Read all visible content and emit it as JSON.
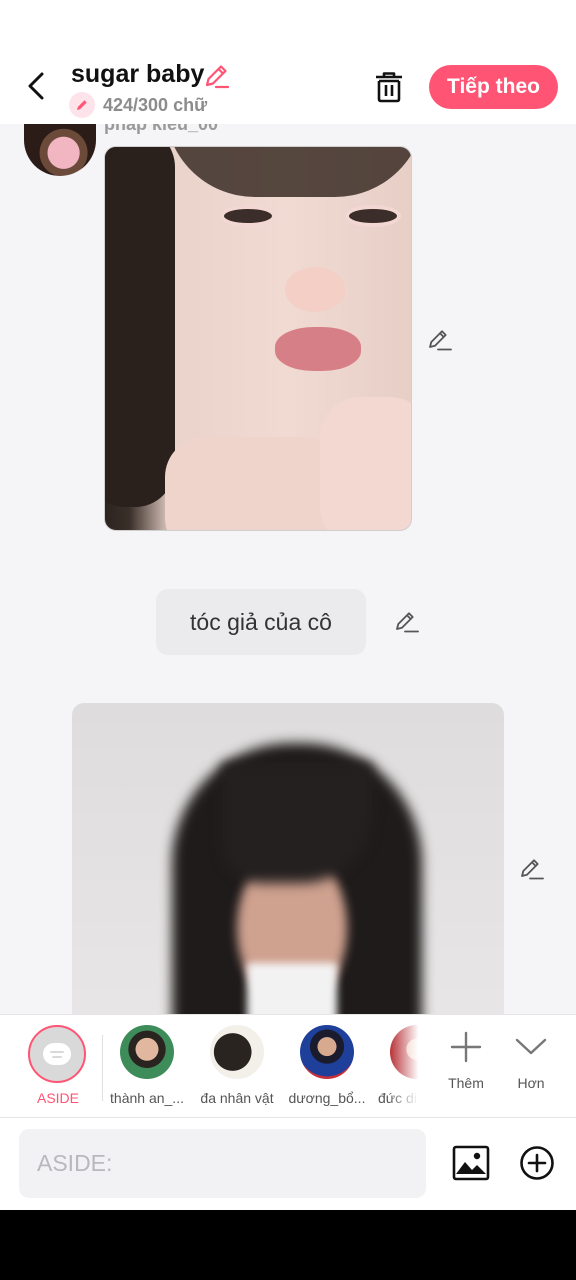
{
  "header": {
    "title": "sugar baby",
    "word_count": "424/300 chữ",
    "next_label": "Tiếp theo"
  },
  "chat": {
    "sender_name": "phap kieu_00",
    "message_text": "tóc giả của cô"
  },
  "characters": {
    "aside_label": "ASIDE",
    "items": [
      {
        "name": "thành an_..."
      },
      {
        "name": "đa nhân vật"
      },
      {
        "name": "dương_bổ..."
      },
      {
        "name": "đức di"
      }
    ],
    "more_label": "Thêm",
    "less_label": "Hơn"
  },
  "composer": {
    "placeholder": "ASIDE:"
  },
  "colors": {
    "accent": "#ff5473",
    "background": "#f5f5f7"
  },
  "icons": [
    "back-arrow-icon",
    "pencil-icon",
    "trash-icon",
    "image-icon",
    "plus-circle-icon",
    "plus-icon",
    "chevron-down-icon"
  ]
}
